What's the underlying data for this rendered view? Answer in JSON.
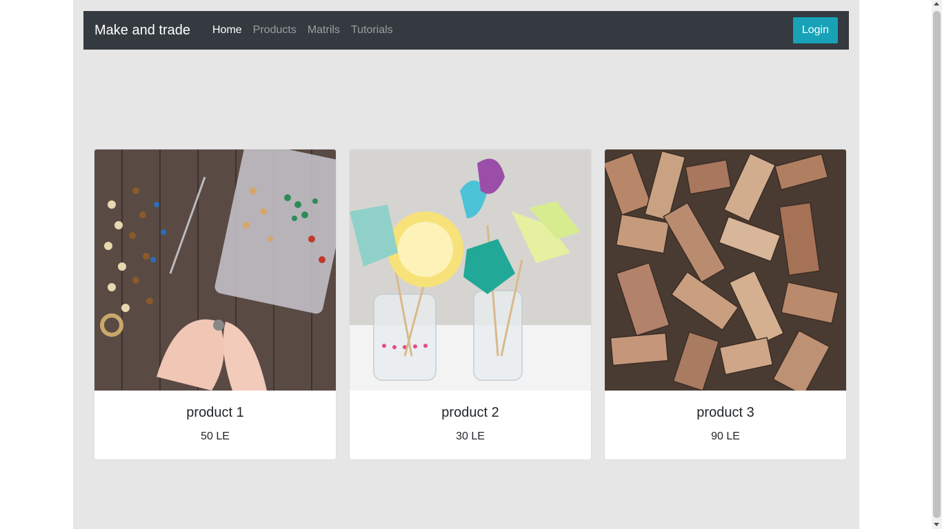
{
  "navbar": {
    "brand": "Make and trade",
    "links": [
      {
        "label": "Home",
        "active": true
      },
      {
        "label": "Products",
        "active": false
      },
      {
        "label": "Matrils",
        "active": false
      },
      {
        "label": "Tutorials",
        "active": false
      }
    ],
    "login_label": "Login"
  },
  "products": [
    {
      "title": "product 1",
      "price": "50 LE",
      "image": "jewelry-beads-photo"
    },
    {
      "title": "product 2",
      "price": "30 LE",
      "image": "paper-flowers-photo"
    },
    {
      "title": "product 3",
      "price": "90 LE",
      "image": "wood-pieces-photo"
    }
  ],
  "colors": {
    "navbar_bg": "#343a40",
    "accent": "#17a2b8",
    "page_bg": "#e6e6e6"
  }
}
